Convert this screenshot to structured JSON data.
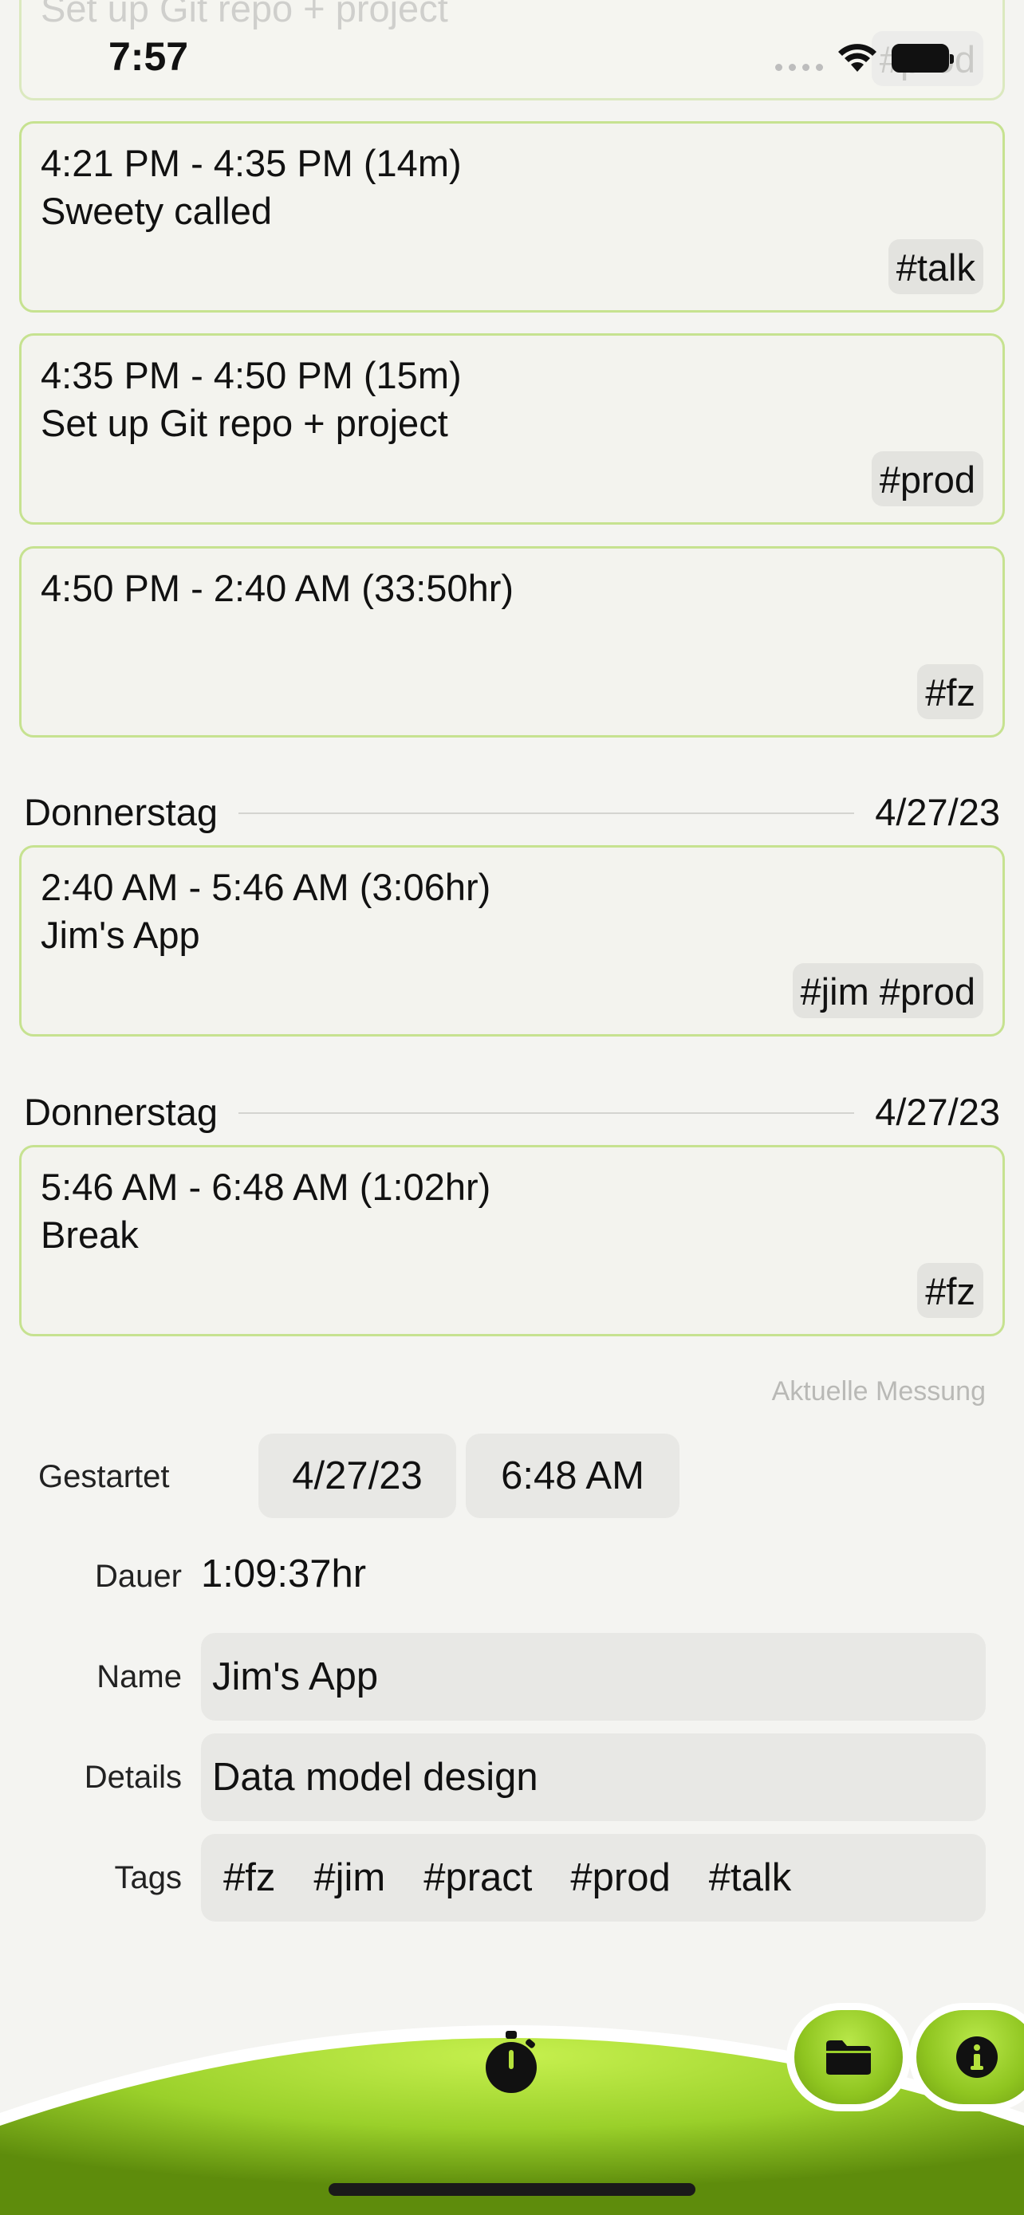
{
  "status_bar": {
    "time": "7:57"
  },
  "top_card": {
    "title": "Set up Git repo + project",
    "tag": "#prod"
  },
  "entries": [
    {
      "time": "4:21 PM - 4:35 PM (14m)",
      "title": "Sweety called",
      "tags": "#talk"
    },
    {
      "time": "4:35 PM - 4:50 PM (15m)",
      "title": "Set up Git repo + project",
      "tags": "#prod"
    },
    {
      "time": "4:50 PM - 2:40 AM (33:50hr)",
      "title": "",
      "tags": "#fz"
    },
    {
      "time": "2:40 AM - 5:46 AM (3:06hr)",
      "title": "Jim's App",
      "tags": "#jim #prod"
    },
    {
      "time": "5:46 AM - 6:48 AM (1:02hr)",
      "title": "Break",
      "tags": "#fz"
    }
  ],
  "day_separators": [
    {
      "day": "Donnerstag",
      "date": "4/27/23"
    },
    {
      "day": "Donnerstag",
      "date": "4/27/23"
    }
  ],
  "current": {
    "section_label": "Aktuelle Messung",
    "started_label": "Gestartet",
    "started_date": "4/27/23",
    "started_time": "6:48 AM",
    "duration_label": "Dauer",
    "duration_value": "1:09:37hr",
    "name_label": "Name",
    "name_value": "Jim's App",
    "details_label": "Details",
    "details_value": "Data model design",
    "tags_label": "Tags",
    "tags": [
      "#fz",
      "#jim",
      "#pract",
      "#prod",
      "#talk"
    ]
  },
  "tab_bar": {
    "stopwatch_icon": "stopwatch-icon",
    "folder_icon": "folder-icon",
    "info_icon": "info-icon"
  },
  "colors": {
    "accent": "#9ad02a",
    "card_border": "#c6e290",
    "background": "#f4f4f1"
  }
}
